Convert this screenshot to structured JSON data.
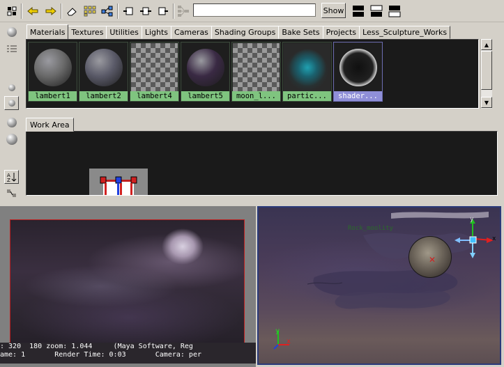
{
  "toolbar": {
    "search_value": "",
    "show_label": "Show"
  },
  "tabs": [
    {
      "label": "Materials",
      "active": true
    },
    {
      "label": "Textures"
    },
    {
      "label": "Utilities"
    },
    {
      "label": "Lights"
    },
    {
      "label": "Cameras"
    },
    {
      "label": "Shading Groups"
    },
    {
      "label": "Bake Sets"
    },
    {
      "label": "Projects"
    },
    {
      "label": "Less_Sculpture_Works"
    }
  ],
  "swatches": [
    {
      "label": "lambert1",
      "kind": "sphere",
      "color": "#6a6a6a"
    },
    {
      "label": "lambert2",
      "kind": "sphere",
      "color": "#5a5a68"
    },
    {
      "label": "lambert4",
      "kind": "checker"
    },
    {
      "label": "lambert5",
      "kind": "sphere",
      "color": "#3a2a44"
    },
    {
      "label": "moon_l...",
      "kind": "checker"
    },
    {
      "label": "partic...",
      "kind": "glow",
      "color": "#20a0b0"
    },
    {
      "label": "shader...",
      "kind": "chrome",
      "selected": true
    }
  ],
  "work_area": {
    "tab_label": "Work Area"
  },
  "render_view": {
    "status_line1": ": 320  180 zoom: 1.044     (Maya Software, Reg",
    "status_line2": "ame: 1       Render Time: 0:03       Camera: per"
  },
  "viewport": {
    "hud_label": "Rock_moolity",
    "axis_x": "x",
    "axis_y": "y",
    "manip_axis_y": "y",
    "manip_axis_x": "x"
  }
}
